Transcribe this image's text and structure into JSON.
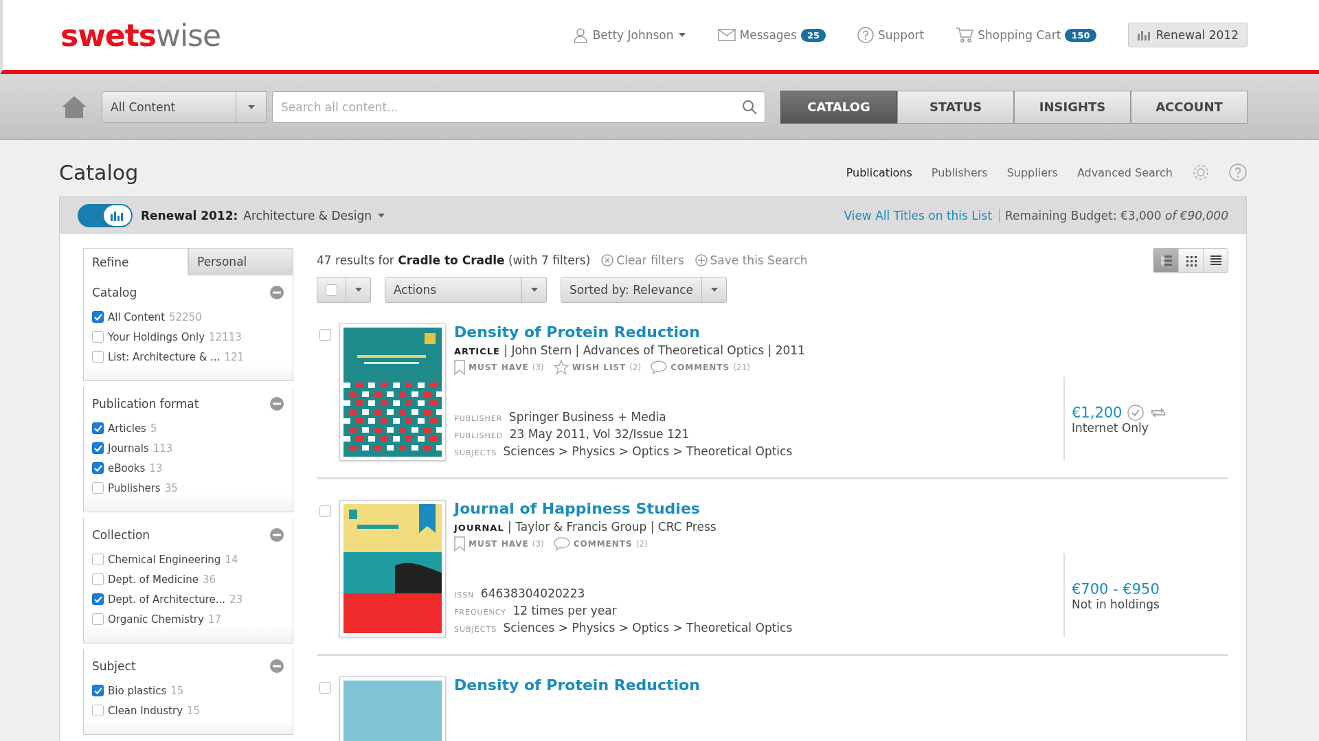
{
  "header": {
    "logo": {
      "first": "swets",
      "second": "wise"
    },
    "user": "Betty Johnson",
    "messages": {
      "label": "Messages",
      "count": "25"
    },
    "support": "Support",
    "cart": {
      "label": "Shopping Cart",
      "count": "150"
    },
    "renewal_button": "Renewal 2012"
  },
  "nav": {
    "scope": "All Content",
    "search": {
      "placeholder": "Search all content..."
    },
    "tabs": [
      {
        "label": "CATALOG",
        "selected": true
      },
      {
        "label": "STATUS",
        "selected": false
      },
      {
        "label": "INSIGHTS",
        "selected": false
      },
      {
        "label": "ACCOUNT",
        "selected": false
      }
    ]
  },
  "page": {
    "title": "Catalog",
    "links": [
      {
        "label": "Publications",
        "selected": true
      },
      {
        "label": "Publishers",
        "selected": false
      },
      {
        "label": "Suppliers",
        "selected": false
      },
      {
        "label": "Advanced Search",
        "selected": false
      }
    ]
  },
  "renewal_bar": {
    "toggle_on": true,
    "list_selector": "**Renewal 2012:** Architecture & Design",
    "view_link": "View All Titles on this List",
    "budget": "Remaining Budget: €3,000 *of €90,000*"
  },
  "sidebar": {
    "tabs": [
      {
        "label": "Refine",
        "selected": true
      },
      {
        "label": "Personal",
        "selected": false
      }
    ],
    "groups": [
      {
        "title": "Catalog",
        "items": [
          {
            "label": "All Content",
            "count": "52250",
            "checked": true
          },
          {
            "label": "Your Holdings Only",
            "count": "12113",
            "checked": false
          },
          {
            "label": "List: Architecture & ...",
            "count": "121",
            "checked": false
          }
        ]
      },
      {
        "title": "Publication format",
        "items": [
          {
            "label": "Articles",
            "count": "5",
            "checked": true
          },
          {
            "label": "Journals",
            "count": "113",
            "checked": true
          },
          {
            "label": "eBooks",
            "count": "13",
            "checked": true
          },
          {
            "label": "Publishers",
            "count": "35",
            "checked": false
          }
        ]
      },
      {
        "title": "Collection",
        "items": [
          {
            "label": "Chemical Engineering",
            "count": "14",
            "checked": false
          },
          {
            "label": "Dept. of Medicine",
            "count": "36",
            "checked": false
          },
          {
            "label": "Dept. of Architecture...",
            "count": "23",
            "checked": true
          },
          {
            "label": "Organic Chemistry",
            "count": "17",
            "checked": false
          }
        ]
      },
      {
        "title": "Subject",
        "items": [
          {
            "label": "Bio plastics",
            "count": "15",
            "checked": true
          },
          {
            "label": "Clean Industry",
            "count": "15",
            "checked": false
          }
        ]
      }
    ]
  },
  "results": {
    "summary": "47 results for **Cradle to Cradle** (with 7 filters)",
    "clear_filters": "Clear filters",
    "save_search": "Save this Search",
    "select_all_checked": false,
    "actions": "Actions",
    "sort": "Sorted by: Relevance",
    "view_modes": [
      {
        "kind": "detail",
        "selected": true
      },
      {
        "kind": "grid",
        "selected": false
      },
      {
        "kind": "list",
        "selected": false
      }
    ],
    "items": [
      {
        "selected": false,
        "cover": {
          "kind": "lattice"
        },
        "bookmarked": false,
        "title": "Density of Protein Reduction",
        "meta": "**ARTICLE** | John Stern | Advances of Theoretical Optics | 2011",
        "actions": [
          {
            "kind": "bookmark",
            "label": "MUST HAVE",
            "count": "(3)"
          },
          {
            "kind": "star",
            "label": "WISH LIST",
            "count": "(2)"
          },
          {
            "kind": "comment",
            "label": "COMMENTS",
            "count": "(21)"
          }
        ],
        "fields": [
          {
            "label": "PUBLISHER",
            "value": "Springer Business + Media"
          },
          {
            "label": "PUBLISHED",
            "value": "23 May 2011, Vol 32/Issue 121"
          },
          {
            "label": "SUBJECTS",
            "value": "Sciences > Physics > Optics > Theoretical Optics"
          }
        ],
        "price": "€1,200",
        "price_note": "Internet Only",
        "price_actions": [
          {
            "kind": "check"
          },
          {
            "kind": "renew"
          }
        ]
      },
      {
        "selected": false,
        "cover": {
          "kind": "bands"
        },
        "bookmarked": true,
        "title": "Journal of Happiness Studies",
        "meta": "**JOURNAL** | Taylor & Francis Group | CRC Press",
        "actions": [
          {
            "kind": "bookmark",
            "label": "MUST HAVE",
            "count": "(3)"
          },
          {
            "kind": "comment",
            "label": "COMMENTS",
            "count": "(2)"
          }
        ],
        "fields": [
          {
            "label": "ISSN",
            "value": "64638304020223"
          },
          {
            "label": "FREQUENCY",
            "value": "12 times per year"
          },
          {
            "label": "SUBJECTS",
            "value": "Sciences > Physics > Optics > Theoretical Optics"
          }
        ],
        "price": "€700 - €950",
        "price_note": "Not in holdings"
      },
      {
        "selected": false,
        "cover": {
          "kind": "plain"
        },
        "bookmarked": false,
        "title": "Density of Protein Reduction"
      }
    ]
  }
}
